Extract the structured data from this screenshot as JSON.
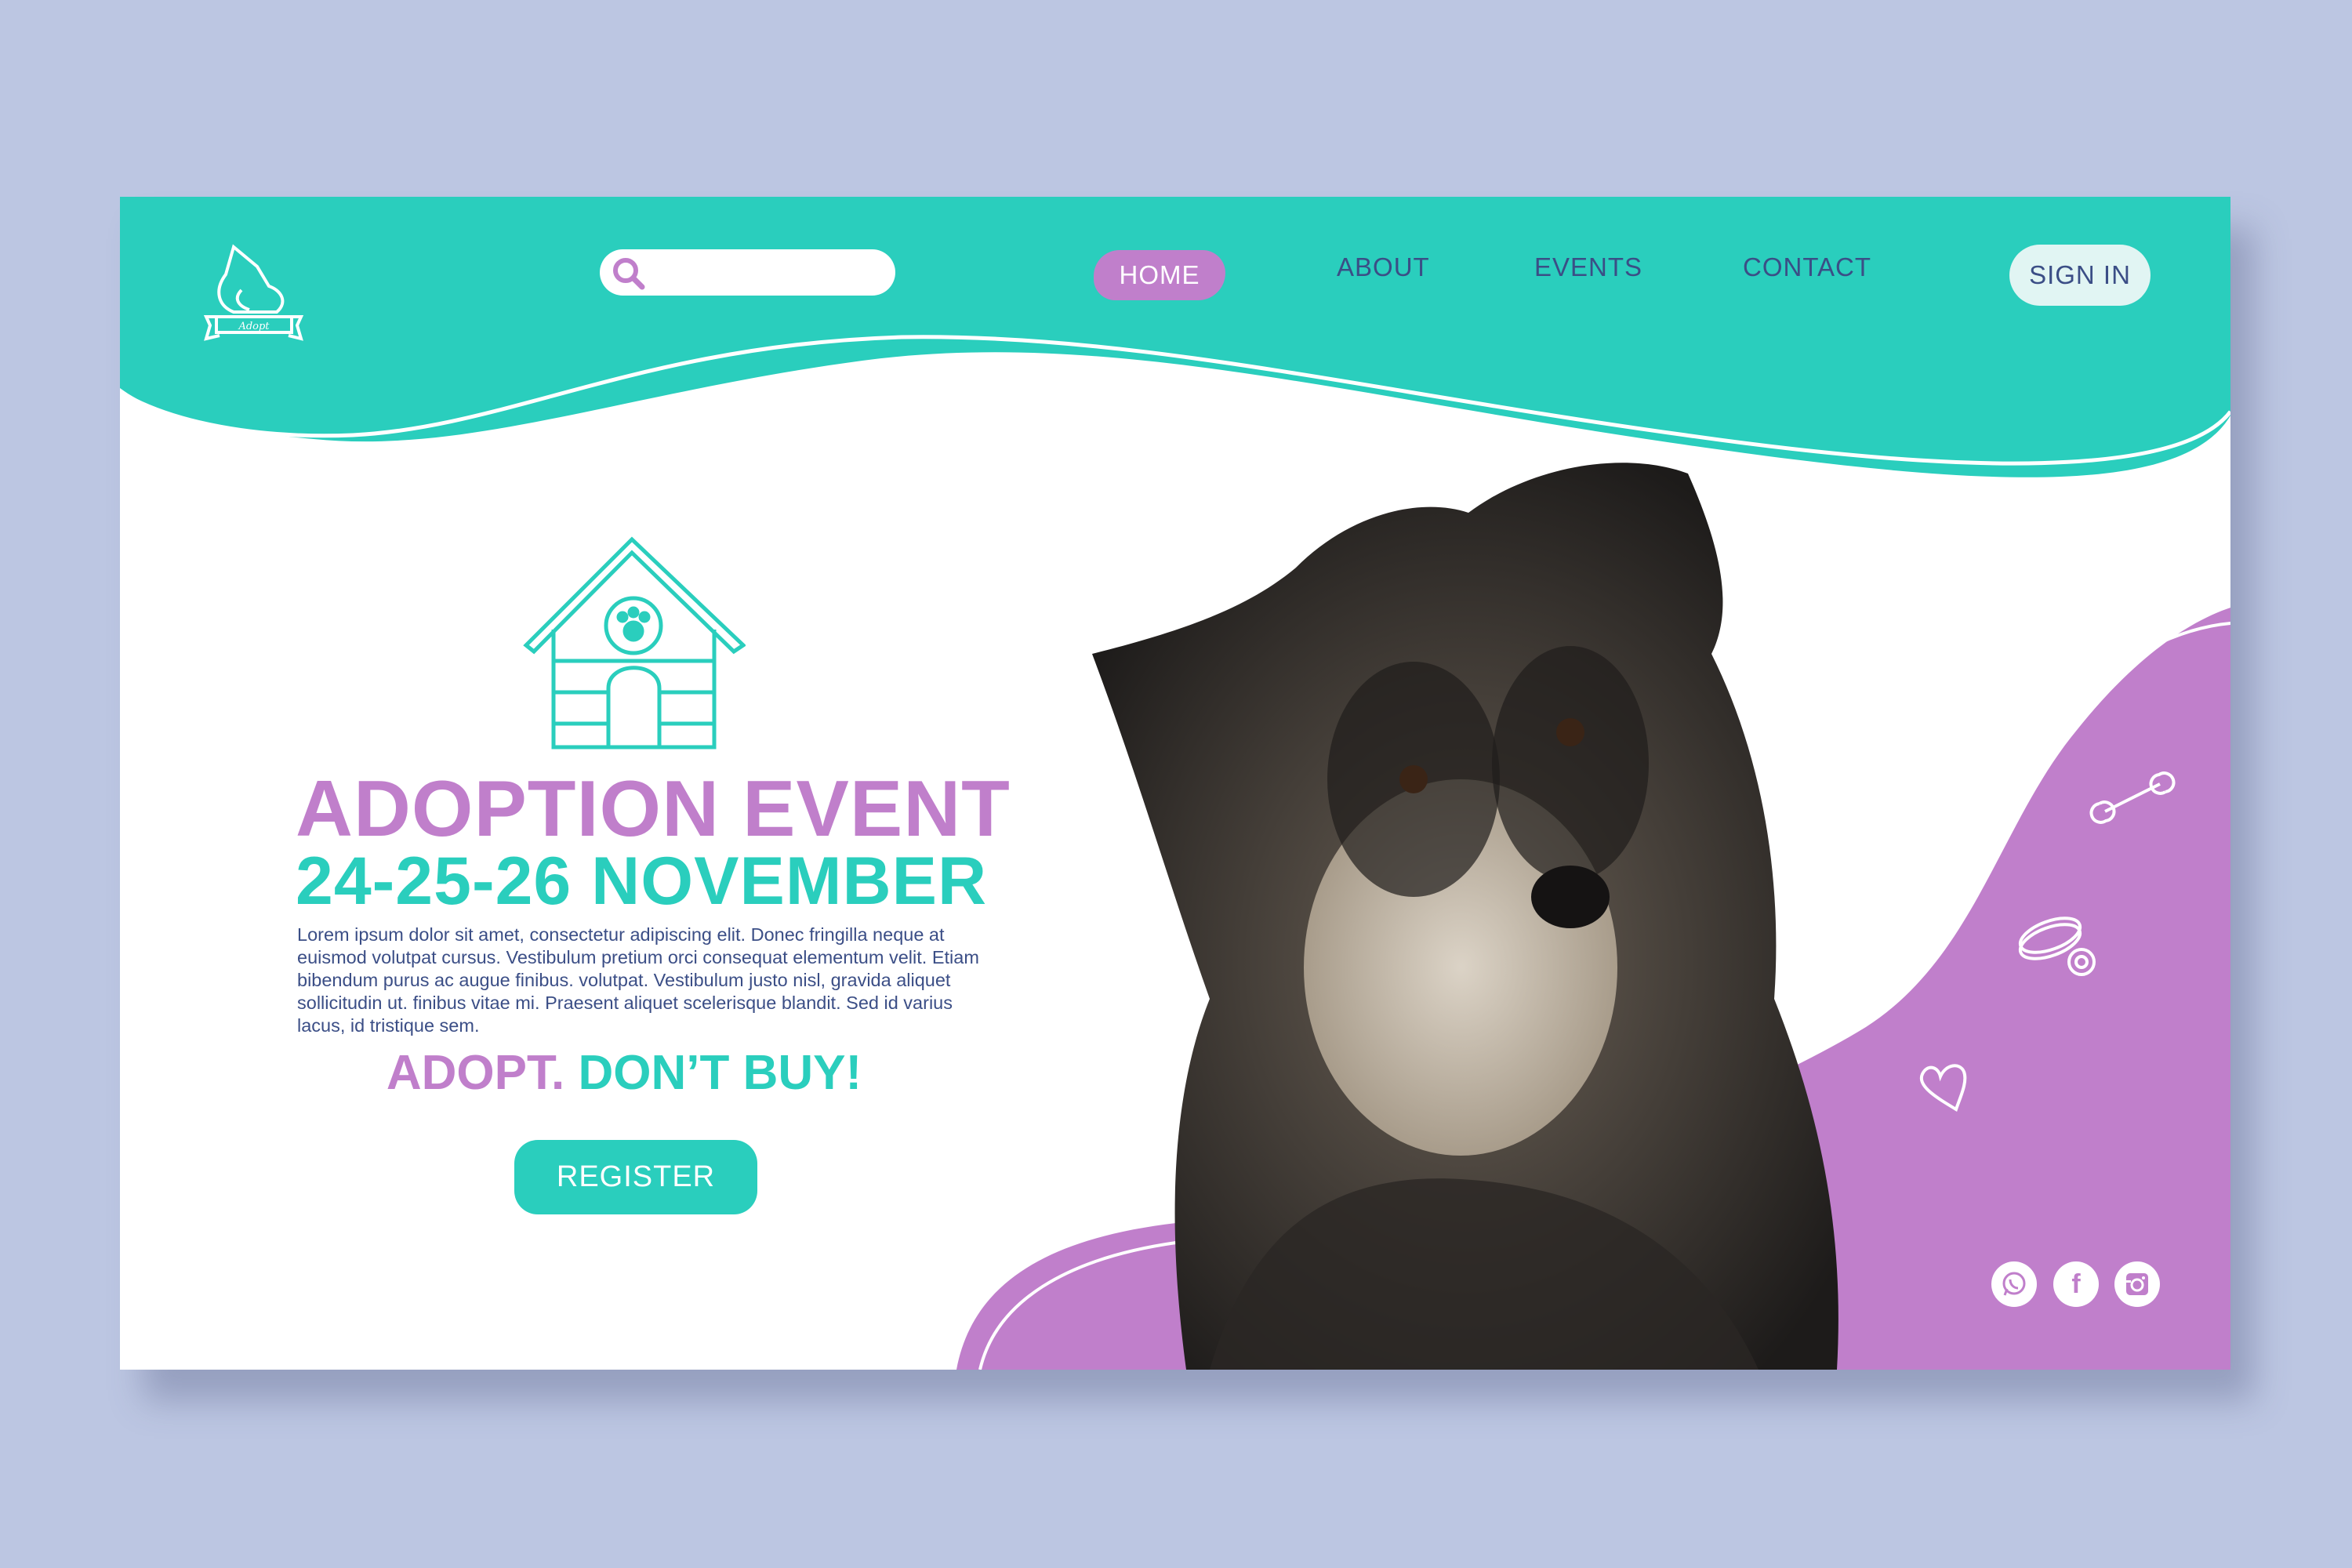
{
  "logo": {
    "text": "Adopt"
  },
  "search": {
    "placeholder": ""
  },
  "nav": {
    "items": [
      {
        "label": "HOME"
      },
      {
        "label": "ABOUT"
      },
      {
        "label": "EVENTS"
      },
      {
        "label": "CONTACT"
      }
    ],
    "sign_in": "SIGN IN"
  },
  "hero": {
    "title": "ADOPTION EVENT",
    "dates": "24-25-26 NOVEMBER",
    "body": "Lorem ipsum dolor sit amet, consectetur adipiscing elit. Donec fringilla neque at euismod volutpat cursus. Vestibulum pretium orci consequat elementum velit. Etiam bibendum purus ac augue finibus. volutpat. Vestibulum justo nisl, gravida aliquet sollicitudin ut. finibus vitae mi. Praesent aliquet scelerisque blandit. Sed id varius lacus, id tristique sem.",
    "slogan_part1": "ADOPT.",
    "slogan_part2": "DON’T BUY!",
    "register": "REGISTER"
  },
  "social": [
    {
      "icon": "whatsapp-icon"
    },
    {
      "icon": "facebook-icon",
      "glyph": "f"
    },
    {
      "icon": "instagram-icon"
    }
  ],
  "colors": {
    "teal": "#2acebd",
    "purple": "#c07fcb",
    "navy": "#3b4e86",
    "background": "#bcc6e2"
  }
}
